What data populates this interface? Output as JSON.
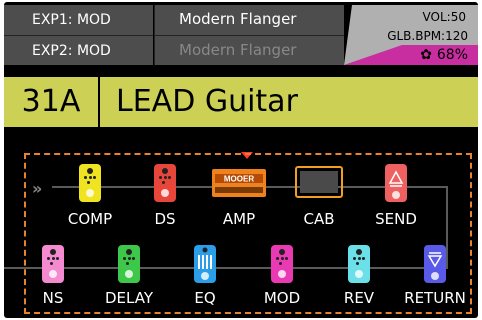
{
  "header": {
    "exp1": "EXP1: MOD",
    "exp2": "EXP2: MOD",
    "current_fx": "Modern Flanger",
    "next_fx": "Modern Flanger",
    "volume": "VOL:50",
    "bpm": "GLB.BPM:120",
    "battery_percent": "68%",
    "battery_icon": "gear-icon"
  },
  "preset": {
    "number": "31A",
    "name": "LEAD Guitar"
  },
  "chain": {
    "row1": [
      {
        "label": "COMP",
        "color": "#f0e421"
      },
      {
        "label": "DS",
        "color": "#e8463a"
      },
      {
        "label": "AMP",
        "color": "#f0821e",
        "brand": "MOOER"
      },
      {
        "label": "CAB",
        "color": "#f0a020"
      },
      {
        "label": "SEND",
        "color": "#ef6060"
      }
    ],
    "row2": [
      {
        "label": "NS",
        "color": "#f48ad0"
      },
      {
        "label": "DELAY",
        "color": "#3ec84a"
      },
      {
        "label": "EQ",
        "color": "#2a9ee8"
      },
      {
        "label": "MOD",
        "color": "#e93ab4"
      },
      {
        "label": "REV",
        "color": "#6be0e8"
      },
      {
        "label": "RETURN",
        "color": "#5a5ae8"
      }
    ]
  },
  "colors": {
    "accent": "#ccd055",
    "battery": "#c82ea0",
    "selection": "#e8822c"
  }
}
